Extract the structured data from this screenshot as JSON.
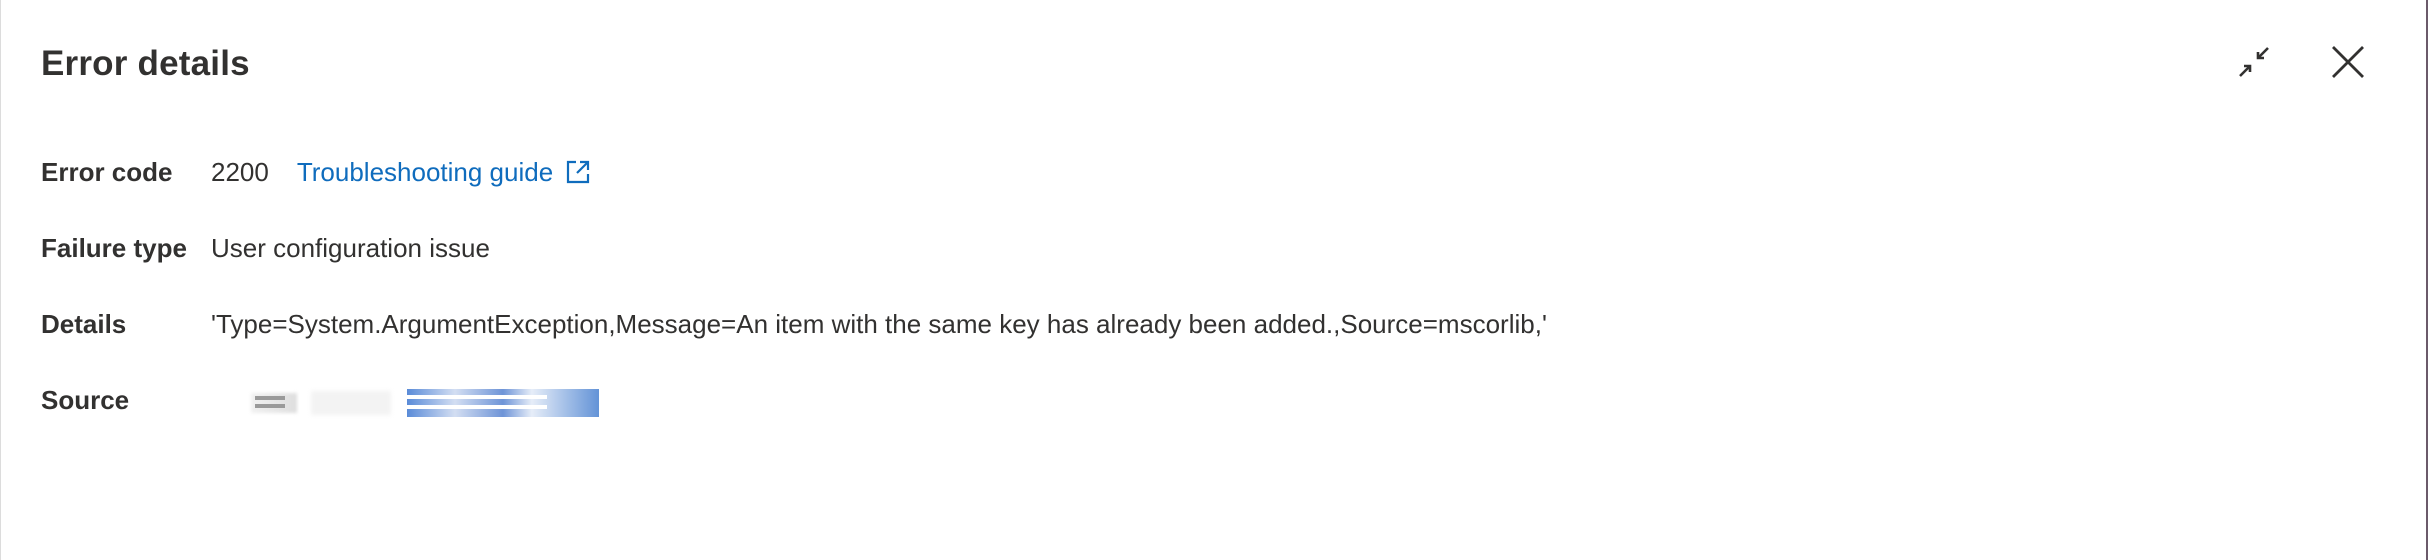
{
  "dialog": {
    "title": "Error details",
    "icons": {
      "minimize": "minimize-icon",
      "close": "close-icon",
      "external_link": "external-link-icon"
    }
  },
  "fields": {
    "error_code": {
      "label": "Error code",
      "value": "2200",
      "link_text": "Troubleshooting guide"
    },
    "failure_type": {
      "label": "Failure type",
      "value": "User configuration issue"
    },
    "details": {
      "label": "Details",
      "value": "'Type=System.ArgumentException,Message=An item with the same key has already been added.,Source=mscorlib,'"
    },
    "source": {
      "label": "Source"
    }
  },
  "colors": {
    "text": "#323130",
    "link": "#0f6cbd"
  }
}
